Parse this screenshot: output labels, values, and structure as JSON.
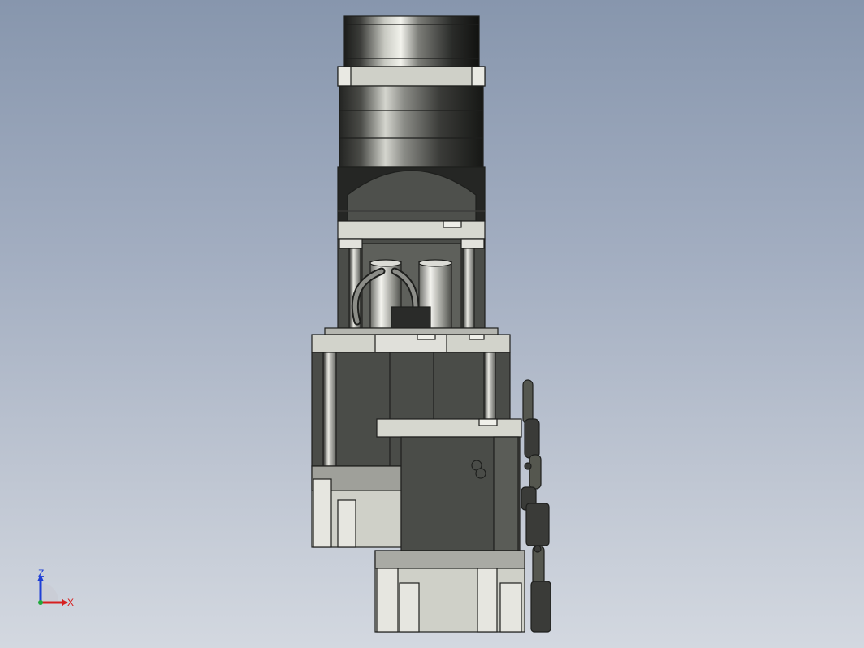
{
  "view": {
    "background_top": "#8796ad",
    "background_bottom": "#d3d8e0"
  },
  "model": {
    "colors": {
      "body_dark": "#4a4c48",
      "body_mid": "#5c5e5a",
      "metal_light": "#cfd0c8",
      "metal_highlight": "#f0f0ea",
      "edge": "#1e1f1d",
      "cylinder_dark": "#2a2b29",
      "cylinder_light": "#b9bab4"
    }
  },
  "triad": {
    "z_label": "Z",
    "x_label": "X",
    "z_color": "#1f3fd6",
    "x_color": "#d61f1f",
    "origin_color": "#1faa3a"
  }
}
